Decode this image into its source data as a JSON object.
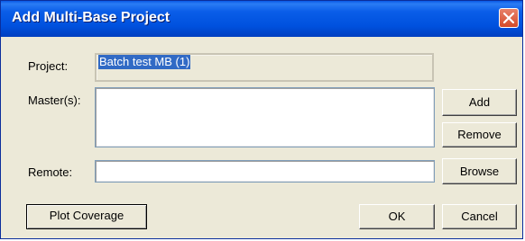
{
  "window": {
    "title": "Add Multi-Base Project",
    "close_icon": "close-icon"
  },
  "form": {
    "project_label": "Project:",
    "project_value": "Batch test MB (1)",
    "masters_label": "Master(s):",
    "remote_label": "Remote:",
    "remote_value": ""
  },
  "buttons": {
    "add": "Add",
    "remove": "Remove",
    "browse": "Browse",
    "plot_coverage": "Plot Coverage",
    "ok": "OK",
    "cancel": "Cancel"
  }
}
